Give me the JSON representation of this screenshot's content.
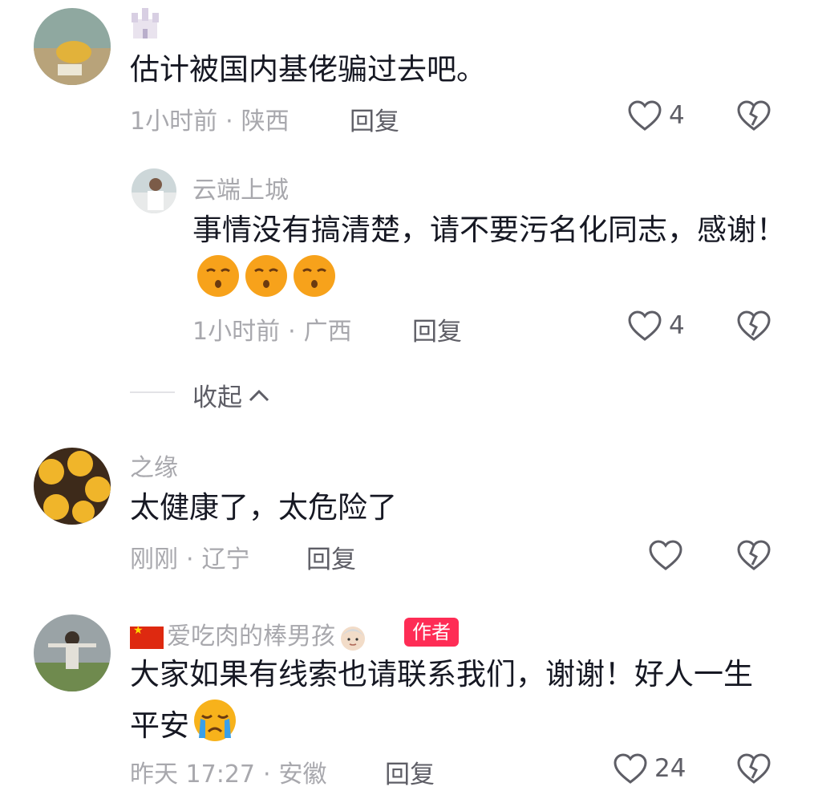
{
  "comments": [
    {
      "username": "",
      "text": "估计被国内基佬骗过去吧。",
      "time": "1小时前",
      "location": "陕西",
      "reply_label": "回复",
      "likes": "4"
    },
    {
      "username": "云端上城",
      "text": "事情没有搞清楚，请不要污名化同志，感谢！",
      "emojis": [
        "smirk-emoji",
        "smirk-emoji",
        "smirk-emoji"
      ],
      "time": "1小时前",
      "location": "广西",
      "reply_label": "回复",
      "likes": "4"
    },
    {
      "username": "之缘",
      "text": "太健康了，太危险了",
      "time": "刚刚",
      "location": "辽宁",
      "reply_label": "回复",
      "likes": ""
    },
    {
      "username": "爱吃肉的棒男孩",
      "badge": "作者",
      "text": "大家如果有线索也请联系我们，谢谢！好人一生平安",
      "emojis": [
        "crying-emoji"
      ],
      "time": "昨天 17:27",
      "location": "安徽",
      "reply_label": "回复",
      "likes": "24"
    }
  ],
  "collapse_label": "收起",
  "colors": {
    "accent": "#fe2c55",
    "muted": "#a8a8ad",
    "text": "#161823"
  }
}
